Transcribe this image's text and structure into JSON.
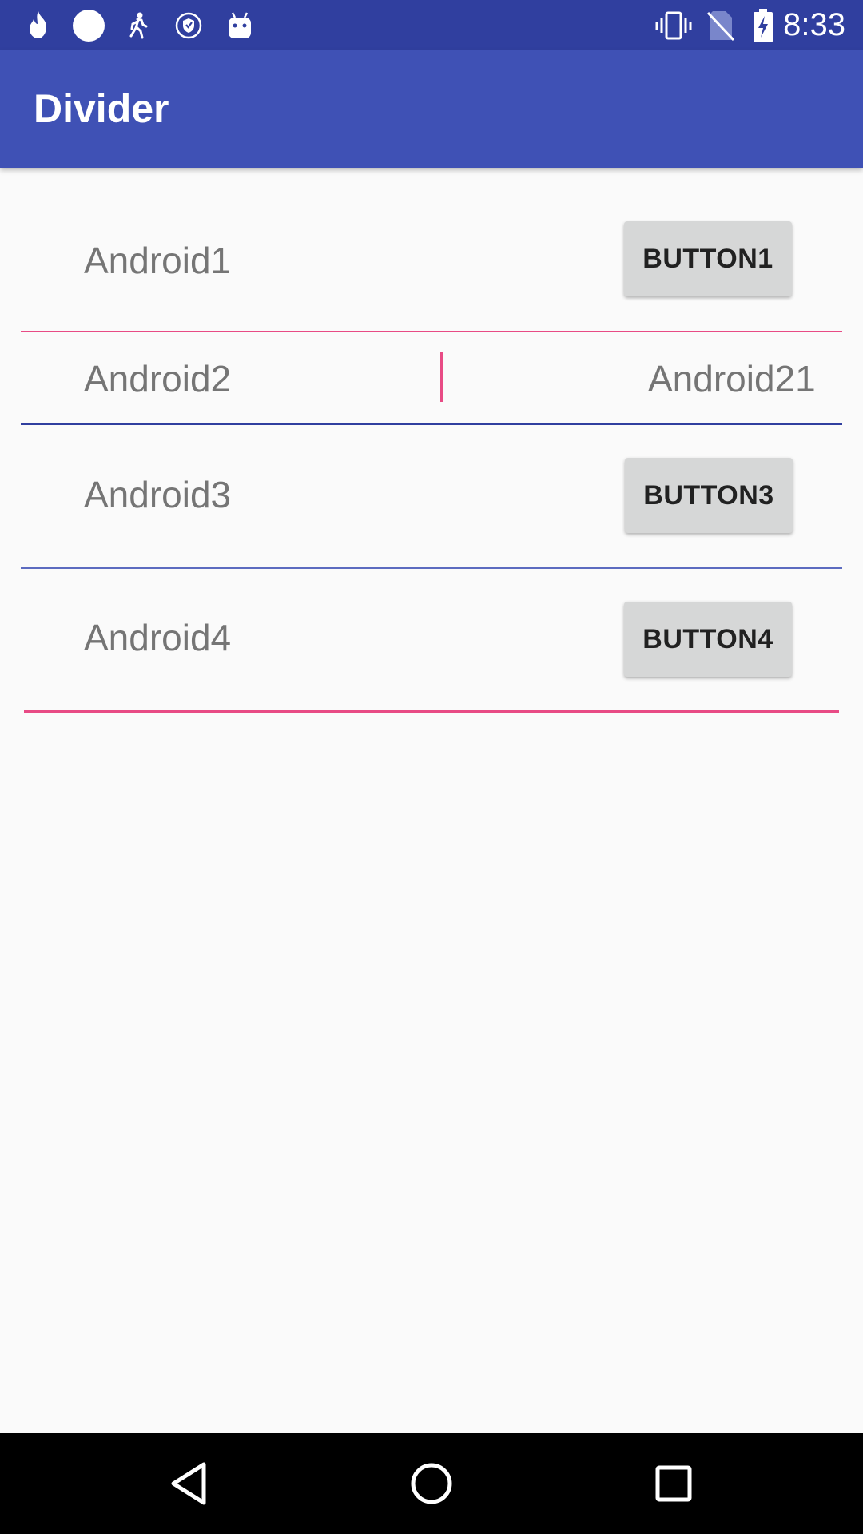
{
  "status_bar": {
    "time": "8:33",
    "left_icons": [
      "fire-icon",
      "circle-icon",
      "walk-icon",
      "shield-icon",
      "android-icon"
    ],
    "right_icons": [
      "vibrate-icon",
      "no-sim-icon",
      "battery-charging-icon"
    ]
  },
  "app_bar": {
    "title": "Divider"
  },
  "rows": [
    {
      "label": "Android1",
      "button": "BUTTON1"
    },
    {
      "label": "Android2",
      "label_right": "Android21"
    },
    {
      "label": "Android3",
      "button": "BUTTON3"
    },
    {
      "label": "Android4",
      "button": "BUTTON4"
    }
  ],
  "colors": {
    "primary": "#3f51b5",
    "primary_dark": "#303f9f",
    "accent": "#e84b85",
    "divider_blue": "#3f51b5",
    "text": "#757575",
    "button_bg": "#d6d7d7"
  },
  "nav_bar": {
    "buttons": [
      "back-icon",
      "home-icon",
      "recents-icon"
    ]
  }
}
